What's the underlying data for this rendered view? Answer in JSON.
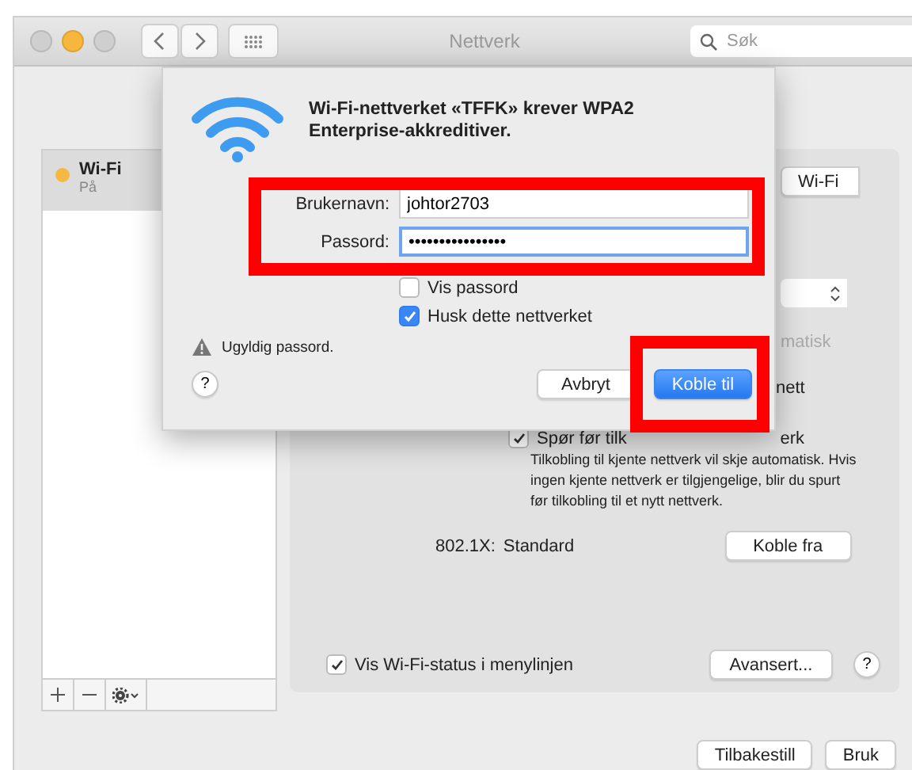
{
  "window": {
    "title": "Nettverk",
    "search": {
      "placeholder": "Søk"
    }
  },
  "sidebar": {
    "items": [
      {
        "name": "Wi-Fi",
        "status": "På",
        "selected": true,
        "color": "#f5b841"
      }
    ]
  },
  "panel": {
    "toggle_button": "Wi-Fi",
    "auto_text": {
      "text": "matisk",
      "disabled": true
    },
    "option_text": "nett",
    "ask_checkbox": {
      "label_start": "Spør før tilk",
      "label_end": "erk",
      "checked": true
    },
    "description": "Tilkobling til kjente nettverk vil skje automatisk. Hvis ingen kjente nettverk er tilgjengelige, blir du spurt før tilkobling til et nytt nettverk.",
    "auth": {
      "label": "802.1X:",
      "value": "Standard",
      "button": "Koble fra"
    },
    "status_checkbox": {
      "label": "Vis Wi-Fi-status i menylinjen",
      "checked": true
    },
    "advanced_button": "Avansert...",
    "help": "?"
  },
  "footer_buttons": [
    "Tilbakestill",
    "Bruk"
  ],
  "dialog": {
    "title": "Wi-Fi-nettverket «TFFK» krever WPA2 Enterprise-akkreditiver.",
    "fields": [
      {
        "label": "Brukernavn:",
        "value": "johtor2703",
        "focused": false
      },
      {
        "label": "Passord:",
        "value": "••••••••••••••••",
        "focused": true
      }
    ],
    "checkboxes": [
      {
        "label": "Vis passord",
        "checked": false
      },
      {
        "label": "Husk dette nettverket",
        "checked": true
      }
    ],
    "warning": "Ugyldig passord.",
    "help": "?",
    "buttons": [
      {
        "label": "Avbryt",
        "primary": false
      },
      {
        "label": "Koble til",
        "primary": true
      }
    ]
  }
}
